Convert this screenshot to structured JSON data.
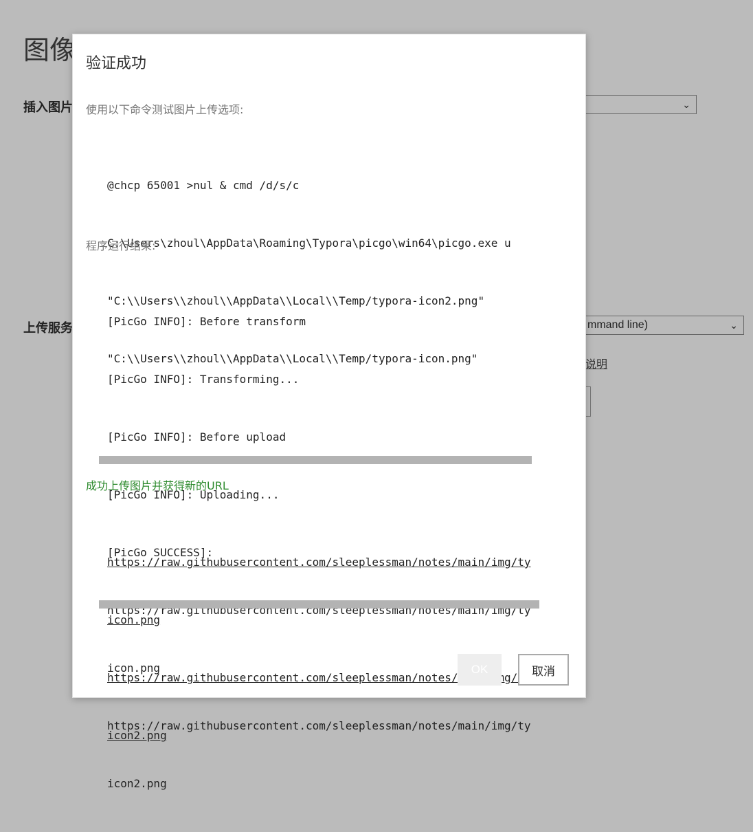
{
  "background": {
    "page_title": "图像",
    "insert_image_label": "插入图片",
    "upload_service_label": "上传服务",
    "upload_service_value": "mmand line)",
    "help_link": "说明"
  },
  "dialog": {
    "title": "验证成功",
    "command_label": "使用以下命令测试图片上传选项:",
    "command_lines": [
      "@chcp 65001 >nul & cmd /d/s/c",
      "C:\\Users\\zhoul\\AppData\\Roaming\\Typora\\picgo\\win64\\picgo.exe u",
      "\"C:\\\\Users\\\\zhoul\\\\AppData\\\\Local\\\\Temp/typora-icon2.png\"",
      "\"C:\\\\Users\\\\zhoul\\\\AppData\\\\Local\\\\Temp/typora-icon.png\""
    ],
    "result_label": "程序运行结果:",
    "result_lines": [
      "[PicGo INFO]: Before transform",
      "[PicGo INFO]: Transforming...",
      "[PicGo INFO]: Before upload",
      "[PicGo INFO]: Uploading...",
      "[PicGo SUCCESS]:",
      "https://raw.githubusercontent.com/sleeplessman/notes/main/img/ty",
      "icon.png",
      "https://raw.githubusercontent.com/sleeplessman/notes/main/img/ty",
      "icon2.png"
    ],
    "success_message": "成功上传图片并获得新的URL",
    "url_lines": [
      "https://raw.githubusercontent.com/sleeplessman/notes/main/img/ty",
      "icon.png",
      "https://raw.githubusercontent.com/sleeplessman/notes/main/img/ty",
      "icon2.png"
    ],
    "ok_label": "OK",
    "cancel_label": "取消"
  }
}
